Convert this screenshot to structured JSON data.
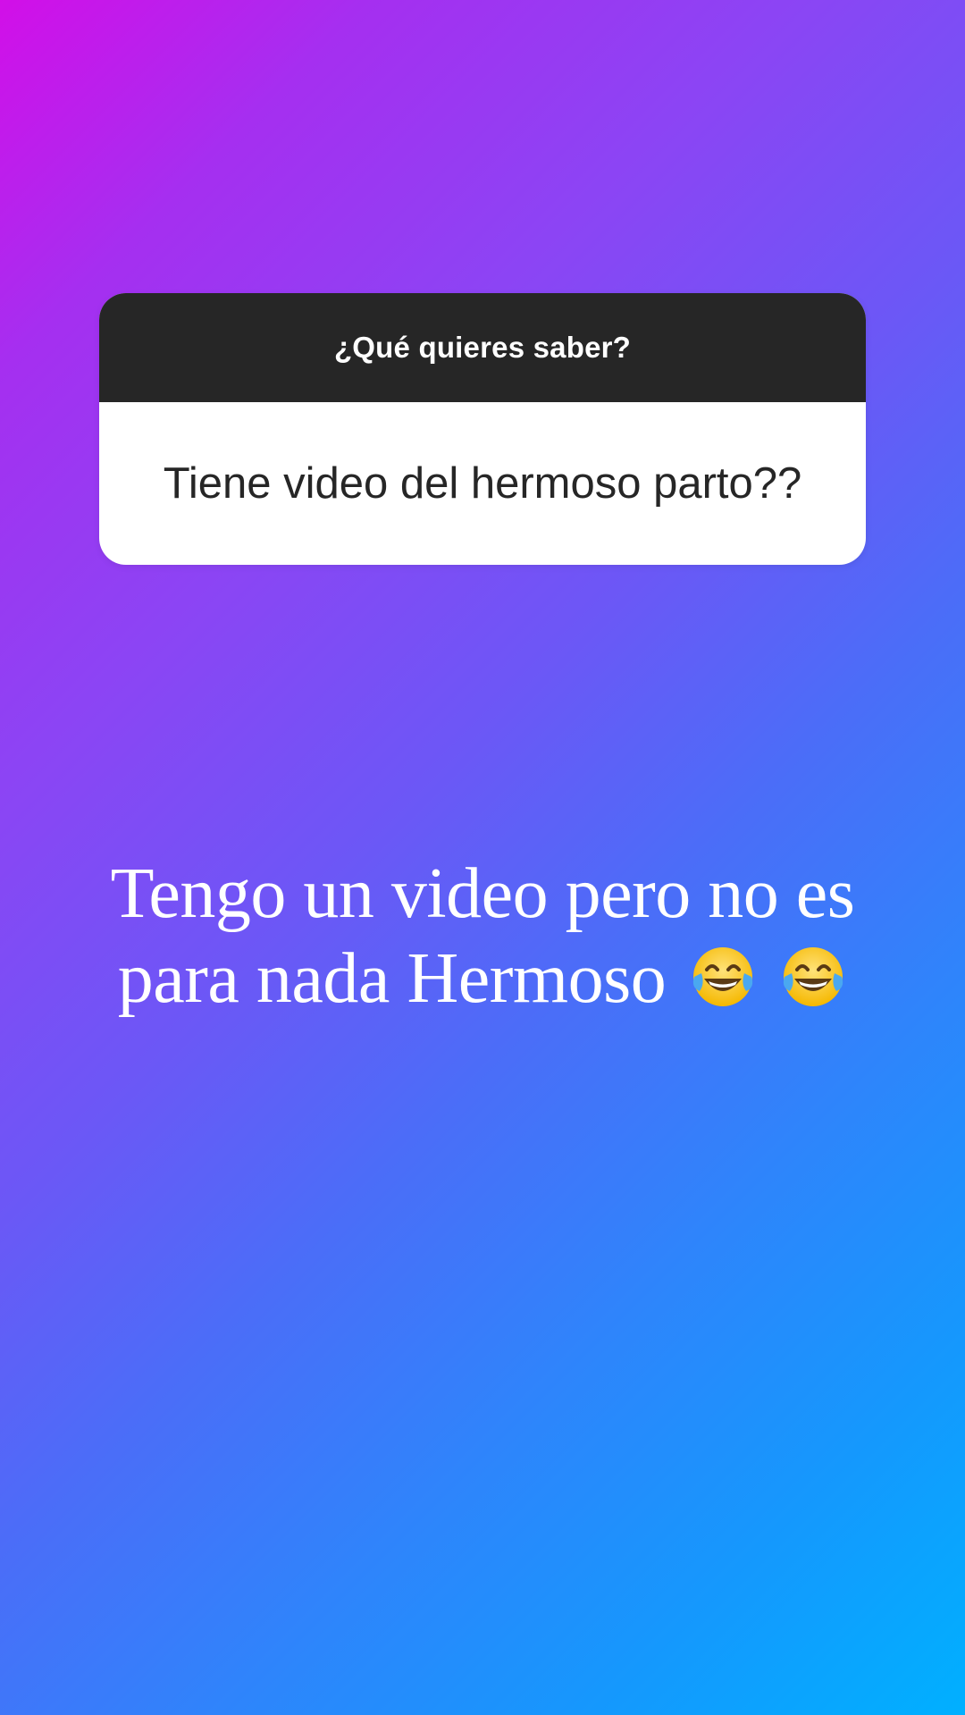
{
  "question_sticker": {
    "prompt": "¿Qué quieres saber?",
    "question": "Tiene video del hermoso parto??"
  },
  "caption": {
    "line1": "Tengo un video pero no es",
    "line2": "para nada Hermoso",
    "emojis": [
      "face-with-tears-of-joy-icon",
      "face-with-tears-of-joy-icon"
    ]
  },
  "colors": {
    "gradient_start": "#d20fe8",
    "gradient_mid": "#6c57f6",
    "gradient_end": "#00b0ff",
    "sticker_header": "#262626",
    "sticker_body": "#ffffff"
  }
}
